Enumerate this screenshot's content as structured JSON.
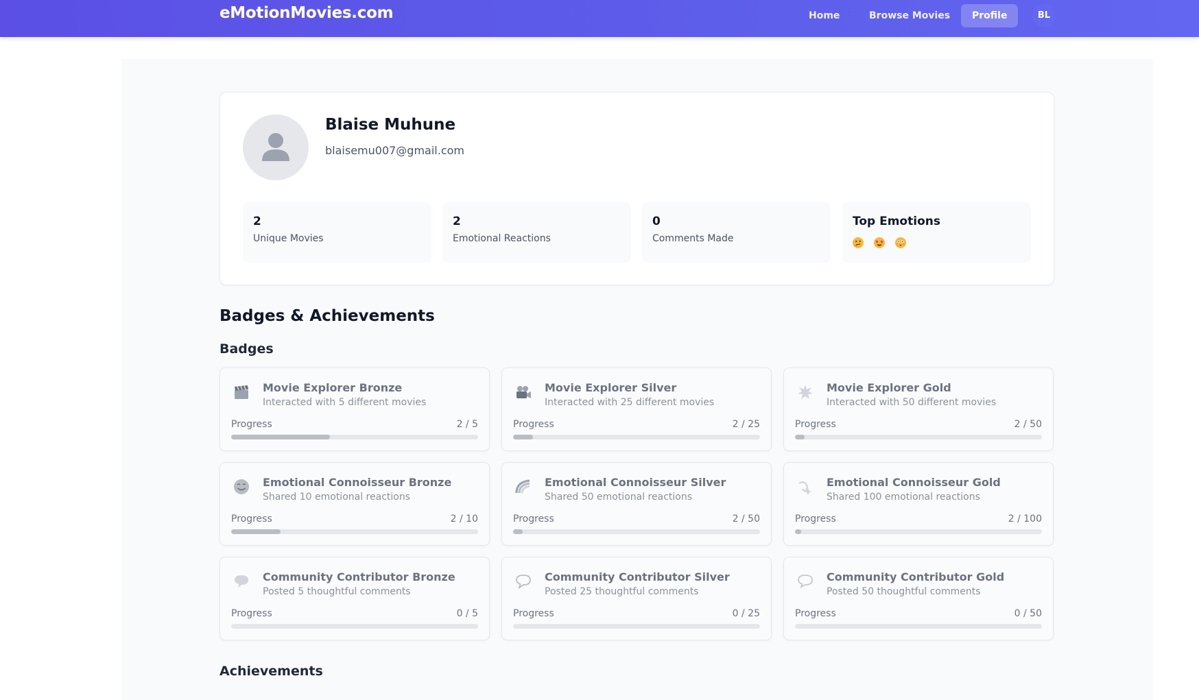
{
  "nav": {
    "brand": "eMotionMovies.com",
    "home": "Home",
    "browse": "Browse Movies",
    "profile": "Profile",
    "avatar_initials": "BL"
  },
  "profile": {
    "name": "Blaise Muhune",
    "email": "blaisemu007@gmail.com",
    "stats": [
      {
        "value": "2",
        "label": "Unique Movies"
      },
      {
        "value": "2",
        "label": "Emotional Reactions"
      },
      {
        "value": "0",
        "label": "Comments Made"
      }
    ],
    "top_emotions": {
      "title": "Top Emotions",
      "icons": [
        "thinking-face-icon",
        "star-struck-face-icon",
        "flushed-face-icon"
      ]
    }
  },
  "sections": {
    "title": "Badges & Achievements",
    "badges_title": "Badges",
    "achievements_title": "Achievements"
  },
  "badges": [
    {
      "title": "Movie Explorer Bronze",
      "desc": "Interacted with 5 different movies",
      "progress_label": "Progress",
      "count": "2 / 5",
      "fraction": 0.4,
      "icon": "clapperboard-icon"
    },
    {
      "title": "Movie Explorer Silver",
      "desc": "Interacted with 25 different movies",
      "progress_label": "Progress",
      "count": "2 / 25",
      "fraction": 0.08,
      "icon": "movie-camera-icon"
    },
    {
      "title": "Movie Explorer Gold",
      "desc": "Interacted with 50 different movies",
      "progress_label": "Progress",
      "count": "2 / 50",
      "fraction": 0.04,
      "icon": "star-burst-icon"
    },
    {
      "title": "Emotional Connoisseur Bronze",
      "desc": "Shared 10 emotional reactions",
      "progress_label": "Progress",
      "count": "2 / 10",
      "fraction": 0.2,
      "icon": "smiling-face-icon"
    },
    {
      "title": "Emotional Connoisseur Silver",
      "desc": "Shared 50 emotional reactions",
      "progress_label": "Progress",
      "count": "2 / 50",
      "fraction": 0.04,
      "icon": "rainbow-icon"
    },
    {
      "title": "Emotional Connoisseur Gold",
      "desc": "Shared 100 emotional reactions",
      "progress_label": "Progress",
      "count": "2 / 100",
      "fraction": 0.02,
      "icon": "dizzy-icon"
    },
    {
      "title": "Community Contributor Bronze",
      "desc": "Posted 5 thoughtful comments",
      "progress_label": "Progress",
      "count": "0 / 5",
      "fraction": 0,
      "icon": "speech-bubble-icon"
    },
    {
      "title": "Community Contributor Silver",
      "desc": "Posted 25 thoughtful comments",
      "progress_label": "Progress",
      "count": "0 / 25",
      "fraction": 0,
      "icon": "speech-balloon-icon"
    },
    {
      "title": "Community Contributor Gold",
      "desc": "Posted 50 thoughtful comments",
      "progress_label": "Progress",
      "count": "0 / 50",
      "fraction": 0,
      "icon": "thought-bubble-icon"
    }
  ]
}
